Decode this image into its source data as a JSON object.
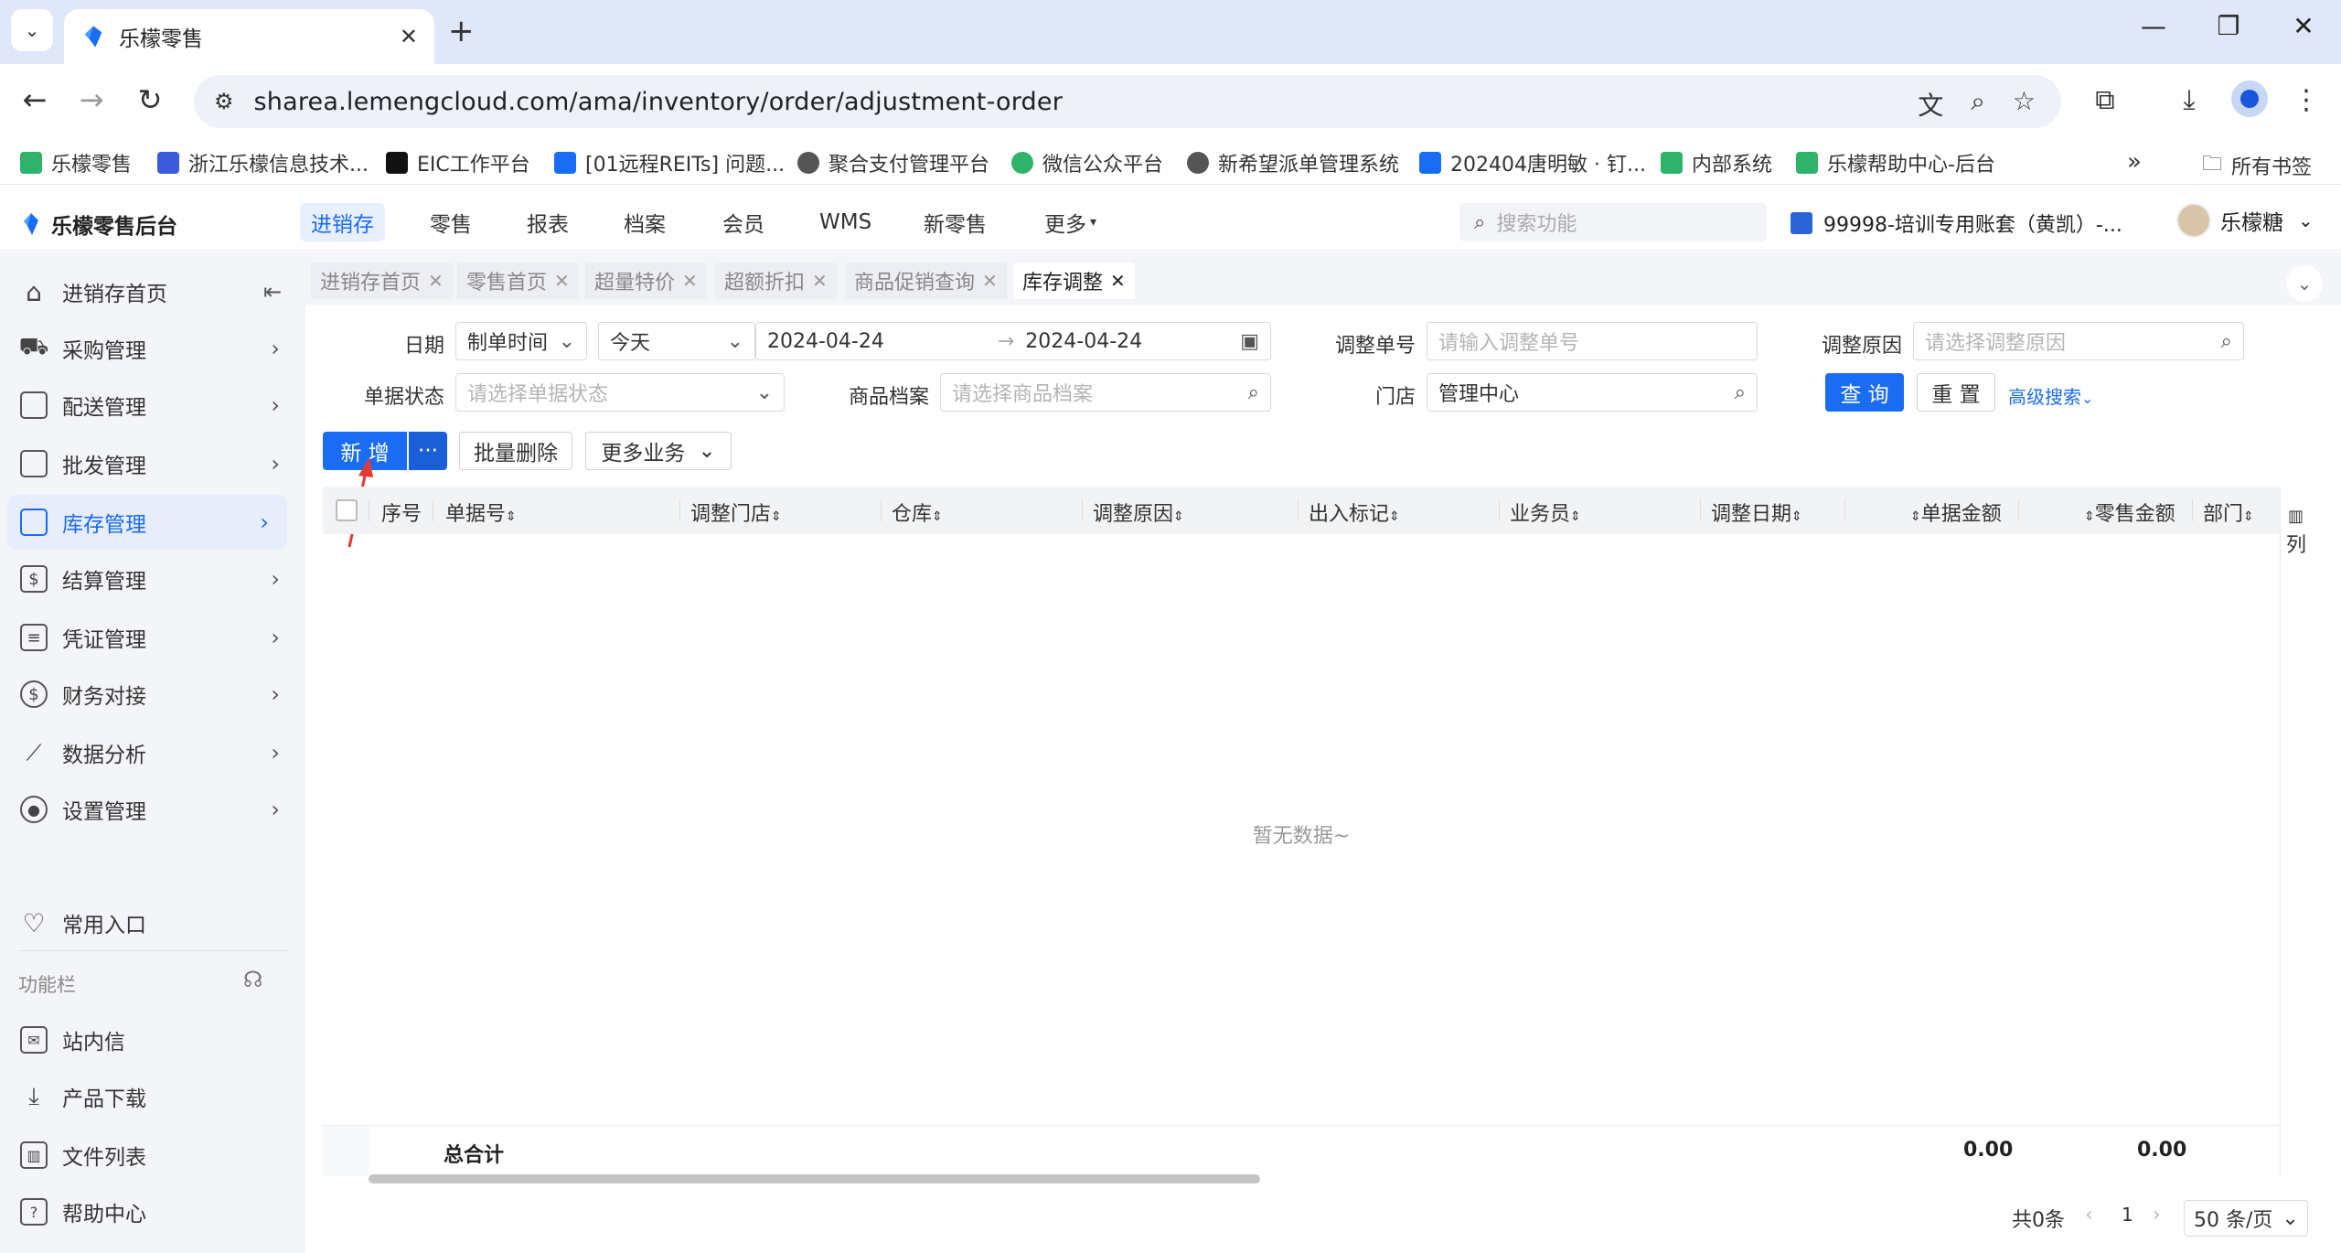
{
  "browser": {
    "tab_title": "乐檬零售",
    "url": "sharea.lemengcloud.com/ama/inventory/order/adjustment-order",
    "bookmarks": [
      {
        "label": "乐檬零售",
        "color": "#2fb36b"
      },
      {
        "label": "浙江乐檬信息技术...",
        "color": "#3b5bdb"
      },
      {
        "label": "EIC工作平台",
        "color": "#111111"
      },
      {
        "label": "[01远程REITs] 问题...",
        "color": "#1a6cf2"
      },
      {
        "label": "聚合支付管理平台",
        "color": "#555555"
      },
      {
        "label": "微信公众平台",
        "color": "#2fb36b"
      },
      {
        "label": "新希望派单管理系统",
        "color": "#555555"
      },
      {
        "label": "202404唐明敏 · 钉...",
        "color": "#1a6cf2"
      },
      {
        "label": "内部系统",
        "color": "#2fb36b"
      },
      {
        "label": "乐檬帮助中心-后台",
        "color": "#2fb36b"
      }
    ],
    "all_bookmarks": "所有书签"
  },
  "header": {
    "logo": "乐檬零售后台",
    "nav": [
      "进销存",
      "零售",
      "报表",
      "档案",
      "会员",
      "WMS",
      "新零售",
      "更多"
    ],
    "active_nav": "进销存",
    "search_placeholder": "搜索功能",
    "account": "99998-培训专用账套（黄凯）-...",
    "user": "乐檬糖"
  },
  "sidebar": {
    "items": [
      {
        "label": "进销存首页",
        "icon": "home-icon"
      },
      {
        "label": "采购管理",
        "icon": "cart-icon"
      },
      {
        "label": "配送管理",
        "icon": "delivery-icon"
      },
      {
        "label": "批发管理",
        "icon": "wholesale-icon"
      },
      {
        "label": "库存管理",
        "icon": "inventory-icon"
      },
      {
        "label": "结算管理",
        "icon": "settlement-icon"
      },
      {
        "label": "凭证管理",
        "icon": "voucher-icon"
      },
      {
        "label": "财务对接",
        "icon": "finance-icon"
      },
      {
        "label": "数据分析",
        "icon": "chart-icon"
      },
      {
        "label": "设置管理",
        "icon": "settings-icon"
      }
    ],
    "favorites": "常用入口",
    "section": "功能栏",
    "tools": [
      {
        "label": "站内信",
        "icon": "mail-icon"
      },
      {
        "label": "产品下载",
        "icon": "download-icon"
      },
      {
        "label": "文件列表",
        "icon": "file-list-icon"
      },
      {
        "label": "帮助中心",
        "icon": "help-icon"
      }
    ]
  },
  "page_tabs": [
    "进销存首页",
    "零售首页",
    "超量特价",
    "超额折扣",
    "商品促销查询",
    "库存调整"
  ],
  "filters": {
    "date_label": "日期",
    "date_type": "制单时间",
    "date_range": "今天",
    "date_start": "2024-04-24",
    "date_end": "2024-04-24",
    "order_no_label": "调整单号",
    "order_no_placeholder": "请输入调整单号",
    "reason_label": "调整原因",
    "reason_placeholder": "请选择调整原因",
    "status_label": "单据状态",
    "status_placeholder": "请选择单据状态",
    "product_label": "商品档案",
    "product_placeholder": "请选择商品档案",
    "store_label": "门店",
    "store_value": "管理中心",
    "query_btn": "查 询",
    "reset_btn": "重 置",
    "advanced": "高级搜索"
  },
  "actions": {
    "add": "新 增",
    "more_icon": "···",
    "batch_delete": "批量删除",
    "more_business": "更多业务"
  },
  "table": {
    "columns": [
      "序号",
      "单据号",
      "调整门店",
      "仓库",
      "调整原因",
      "出入标记",
      "业务员",
      "调整日期",
      "单据金额",
      "零售金额",
      "部门"
    ],
    "empty_text": "暂无数据~",
    "total_label": "总合计",
    "total_order_amount": "0.00",
    "total_retail_amount": "0.00",
    "col_settings": "列"
  },
  "pagination": {
    "total": "共0条",
    "page": "1",
    "page_size": "50 条/页"
  }
}
